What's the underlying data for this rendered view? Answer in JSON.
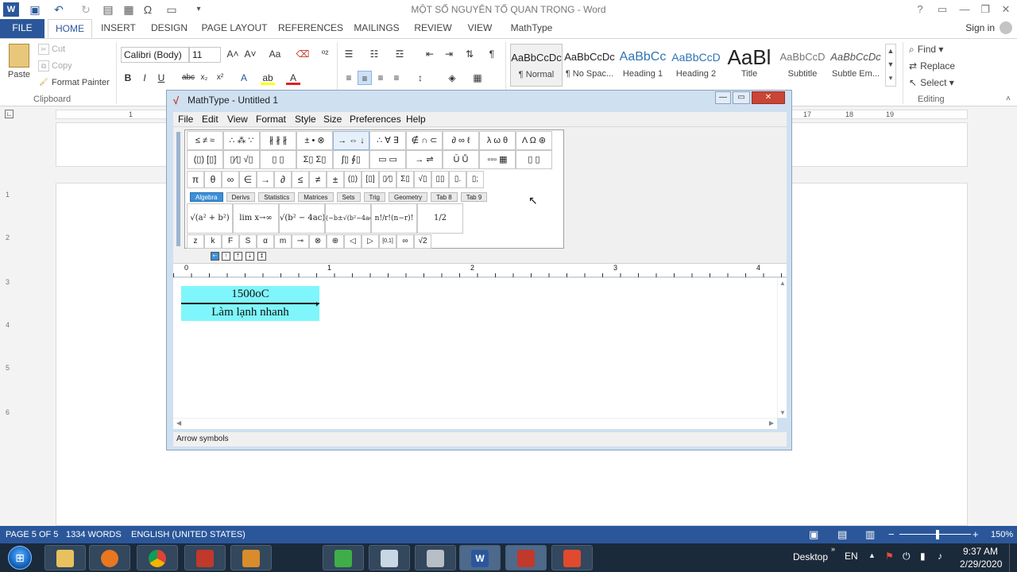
{
  "window": {
    "title": "MỘT SỐ NGUYÊN TỐ QUAN TRỌNG - Word",
    "controls": [
      "?",
      "▭",
      "—",
      "❐",
      "✕"
    ]
  },
  "tabs": [
    {
      "label": "FILE"
    },
    {
      "label": "HOME"
    },
    {
      "label": "INSERT"
    },
    {
      "label": "DESIGN"
    },
    {
      "label": "PAGE LAYOUT"
    },
    {
      "label": "REFERENCES"
    },
    {
      "label": "MAILINGS"
    },
    {
      "label": "REVIEW"
    },
    {
      "label": "VIEW"
    },
    {
      "label": "MathType"
    }
  ],
  "signin": "Sign in",
  "clipboard": {
    "paste": "Paste",
    "cut": "Cut",
    "copy": "Copy",
    "format_painter": "Format Painter",
    "group": "Clipboard"
  },
  "font": {
    "family": "Calibri (Body)",
    "size": "11"
  },
  "styles": [
    {
      "preview": "AaBbCcDc",
      "label": "¶ Normal"
    },
    {
      "preview": "AaBbCcDc",
      "label": "¶ No Spac..."
    },
    {
      "preview": "AaBbCc",
      "label": "Heading 1"
    },
    {
      "preview": "AaBbCcD",
      "label": "Heading 2"
    },
    {
      "preview": "AaBl",
      "label": "Title"
    },
    {
      "preview": "AaBbCcD",
      "label": "Subtitle"
    },
    {
      "preview": "AaBbCcDc",
      "label": "Subtle Em..."
    }
  ],
  "editing": {
    "find": "Find",
    "replace": "Replace",
    "select": "Select",
    "group": "Editing"
  },
  "hruler_numbers": [
    "1",
    "17",
    "18",
    "19"
  ],
  "vruler_numbers": [
    "1",
    "2",
    "3",
    "4",
    "5",
    "6"
  ],
  "mathtype": {
    "title": "MathType - Untitled 1",
    "menus": [
      "File",
      "Edit",
      "View",
      "Format",
      "Style",
      "Size",
      "Preferences",
      "Help"
    ],
    "palette_row1": [
      "≤ ≠ ≈",
      "∴ ⁂ ∵",
      "∦ ∦ ∦",
      "± • ⊗",
      "→ ⇔ ↓",
      "∴ ∀ ∃",
      "∉ ∩ ⊂",
      "∂ ∞ ℓ",
      "λ ω θ",
      "Λ Ω ⊛"
    ],
    "palette_row2": [
      "(▯) [▯]",
      "▯⁄▯ √▯",
      "▯ ▯",
      "Σ▯ Σ▯",
      "∫▯ ∮▯",
      "▭ ▭",
      "→ ⇌",
      "Ū Ů",
      "▫▫▫ ▦",
      "▯ ▯"
    ],
    "symbol_row": [
      "π",
      "θ",
      "∞",
      "∈",
      "→",
      "∂",
      "≤",
      "≠",
      "±",
      "(▯)",
      "[▯]",
      "▯⁄▯",
      "Σ▯",
      "√▯",
      "▯▯",
      "▯.",
      "▯;"
    ],
    "palette_tabs": [
      "Algebra",
      "Derivs",
      "Statistics",
      "Matrices",
      "Sets",
      "Trig",
      "Geometry",
      "Tab 8",
      "Tab 9"
    ],
    "templates": [
      "√(a² + b²)",
      "lim x→∞",
      "√(b² − 4ac)",
      "(−b±√(b²−4ac))/2a",
      "n!/r!(n−r)!",
      "1/2"
    ],
    "bottom_row": [
      "z",
      "k",
      "F",
      "S",
      "α",
      "m",
      "⊸",
      "⊗",
      "⊕",
      "◁",
      "▷",
      "[0,1]",
      "∞",
      "√2"
    ],
    "ruler_numbers": [
      "0",
      "1",
      "2",
      "3",
      "4"
    ],
    "equation": {
      "top": "1500oC",
      "bottom": "Làm lạnh nhanh"
    },
    "status": "Arrow symbols"
  },
  "statusbar": {
    "page": "PAGE 5 OF 5",
    "words": "1334 WORDS",
    "language": "ENGLISH (UNITED STATES)",
    "zoom": "150%"
  },
  "taskbar": {
    "desktop": "Desktop",
    "lang": "EN",
    "time": "9:37 AM",
    "date": "2/29/2020",
    "app_icons": [
      "folder-icon",
      "media-player-icon",
      "chrome-icon",
      "red-app-icon",
      "mail-app-icon",
      "camtasia-icon",
      "paint-icon",
      "calculator-icon",
      "word-icon",
      "mathtype-icon",
      "camtasia-recorder-icon"
    ]
  },
  "colors": {
    "word_blue": "#2b579a",
    "equation_bg": "#7ff6fb",
    "taskbar": "#1b2a3a"
  }
}
